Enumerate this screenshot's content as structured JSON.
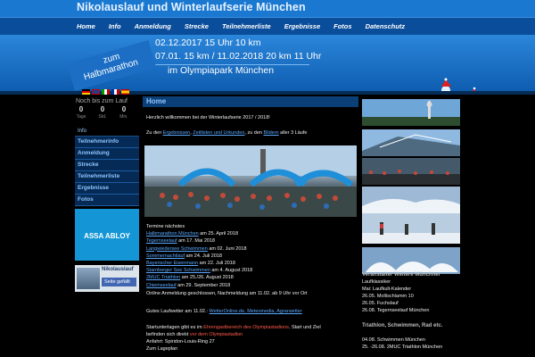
{
  "site": {
    "title": "Nikolauslauf und Winterlaufserie München"
  },
  "nav": [
    "Home",
    "Info",
    "Anmeldung",
    "Strecke",
    "Teilnehmerliste",
    "Ergebnisse",
    "Fotos",
    "Datenschutz"
  ],
  "banner": {
    "badge_line1": "zum",
    "badge_line2": "Halbmarathon",
    "dates_line1": "02.12.2017 15 Uhr 10 km",
    "dates_line2": "07.01. 15 km / 11.02.2018 20 km 11 Uhr",
    "venue": "im Olympiapark München"
  },
  "countdown": {
    "label": "Noch bis zum Lauf",
    "values": [
      "0",
      "0",
      "0"
    ],
    "units": [
      "Tage",
      "Std.",
      "Min."
    ]
  },
  "sidebar": {
    "header": "Info",
    "items": [
      "Teilnehmerinfo",
      "Anmeldung",
      "Strecke",
      "Teilnehmerliste",
      "Ergebnisse",
      "Fotos"
    ]
  },
  "ads": {
    "assa": "ASSA ABLOY",
    "fb_name": "Nikolauslauf",
    "fb_like": "Seite gefällt"
  },
  "main": {
    "title": "Home",
    "welcome": "Herzlich willkommen bei der Winterlaufserie 2017 / 2018!",
    "links_pre": "Zu den ",
    "link_results": "Ergebnissen",
    "links_mid1": ", ",
    "link_times": "Zeitlisten und Urkunden",
    "links_mid2": ", zu den ",
    "link_photos": "Bildern",
    "links_post": " aller 3 Läufe",
    "races_header": "Termine nächstes",
    "races": [
      {
        "name": "Halbmarathon München",
        "date": " am 25. April 2018"
      },
      {
        "name": "Tegernseelauf",
        "date": " am 17. Mai 2018"
      },
      {
        "name": "Langwiedersee Schwimmen",
        "date": " am 02. Juni 2018"
      },
      {
        "name": "Sommernachtlauf",
        "date": " am 24. Juli 2018"
      },
      {
        "name": "Bayerischer Eisenmann",
        "date": " am 22. Juli 2018"
      },
      {
        "name": "Starnberger See Schwimmen",
        "date": " am 4. August 2018"
      },
      {
        "name": "2MUC Triathlon",
        "date": " am 25./26. August 2018"
      },
      {
        "name": "Chiemseelauf",
        "date": " am 29. September 2018"
      }
    ],
    "online_note": "Online Anmeldung geschlossen, Nachmeldung am 11.02. ab 9 Uhr vor Ort",
    "partner_pre": "Gutes Laufwetter am 11.02.: ",
    "partner_link": "WetterOnline.de, Meteomedia, Agrarwetter",
    "footer1_pre": "Startunterlagen gibt es im ",
    "footer1_red": "Ehrengastbereich des Olympiastadions",
    "footer1_post": ". Start und Ziel",
    "footer2_pre": "befinden sich direkt ",
    "footer2_red": "vor dem Olympiastadion",
    "footer3": "Anfahrt: Spiridon-Louis-Ring 27",
    "footer4": "Zum Lageplan"
  },
  "right": {
    "head1": "Veranstalter Weitere Münchner",
    "head1b": "Laufklassiker",
    "items1": [
      "Mai: Laufkult-Kalender",
      "26.05. Mollischlamm 10",
      "26.05. Fuchslauf",
      "26.08. Tegernseelauf München"
    ],
    "head2": "Triathlon, Schwimmen, Rad etc.",
    "items2": [
      "04.08. Schwimmen München",
      "25. -26.08. 2MUC Triathlon München"
    ]
  },
  "colors": {
    "accent": "#1a78d0",
    "nav": "#0a4d9a",
    "link": "#5aa8ff"
  }
}
